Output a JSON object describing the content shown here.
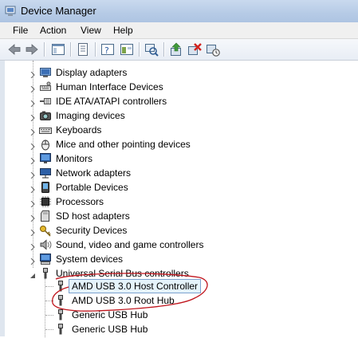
{
  "window": {
    "title": "Device Manager"
  },
  "menu": [
    "File",
    "Action",
    "View",
    "Help"
  ],
  "toolbar": {
    "buttons": [
      "back-arrow-icon",
      "forward-arrow-icon",
      "show-hide-console-tree-icon",
      "properties-icon",
      "help-icon",
      "scan-for-hardware-changes-icon",
      "update-driver-icon",
      "uninstall-icon",
      "disable-icon"
    ]
  },
  "tree": {
    "categories": [
      {
        "label": "Display adapters",
        "icon": "display-adapter-icon"
      },
      {
        "label": "Human Interface Devices",
        "icon": "hid-icon"
      },
      {
        "label": "IDE ATA/ATAPI controllers",
        "icon": "ide-controller-icon"
      },
      {
        "label": "Imaging devices",
        "icon": "camera-icon"
      },
      {
        "label": "Keyboards",
        "icon": "keyboard-icon"
      },
      {
        "label": "Mice and other pointing devices",
        "icon": "mouse-icon"
      },
      {
        "label": "Monitors",
        "icon": "monitor-icon"
      },
      {
        "label": "Network adapters",
        "icon": "network-adapter-icon"
      },
      {
        "label": "Portable Devices",
        "icon": "portable-device-icon"
      },
      {
        "label": "Processors",
        "icon": "processor-icon"
      },
      {
        "label": "SD host adapters",
        "icon": "sd-host-icon"
      },
      {
        "label": "Security Devices",
        "icon": "security-key-icon"
      },
      {
        "label": "Sound, video and game controllers",
        "icon": "speaker-icon"
      },
      {
        "label": "System devices",
        "icon": "system-device-icon"
      },
      {
        "label": "Universal Serial Bus controllers",
        "icon": "usb-icon",
        "expanded": true
      }
    ],
    "usb_children": [
      {
        "label": "AMD USB 3.0 Host Controller",
        "selected": true
      },
      {
        "label": "AMD USB 3.0 Root Hub"
      },
      {
        "label": "Generic USB Hub"
      },
      {
        "label": "Generic USB Hub"
      }
    ]
  },
  "colors": {
    "annotation": "#c0141c",
    "selection_border": "#7da2ce",
    "selection_fill": "#e5f3fb"
  }
}
